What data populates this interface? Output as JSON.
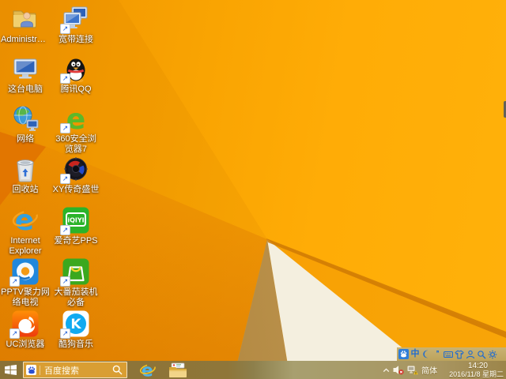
{
  "desktop": {
    "icons": [
      {
        "name": "administrator",
        "label": "Administrator",
        "shortcut": false
      },
      {
        "name": "broadband-connection",
        "label": "宽带连接",
        "shortcut": true
      },
      {
        "name": "this-pc",
        "label": "这台电脑",
        "shortcut": false
      },
      {
        "name": "tencent-qq",
        "label": "腾讯QQ",
        "shortcut": true
      },
      {
        "name": "network",
        "label": "网络",
        "shortcut": false
      },
      {
        "name": "360-browser",
        "label": "360安全浏览器7",
        "shortcut": true
      },
      {
        "name": "recycle-bin",
        "label": "回收站",
        "shortcut": false
      },
      {
        "name": "xy-game",
        "label": "XY传奇盛世",
        "shortcut": true
      },
      {
        "name": "internet-explorer",
        "label": "Internet Explorer",
        "shortcut": false
      },
      {
        "name": "iqiyi-pps",
        "label": "爱奇艺PPS",
        "shortcut": true
      },
      {
        "name": "pptv",
        "label": "PPTV聚力网络电视",
        "shortcut": true
      },
      {
        "name": "datomato",
        "label": "大番茄装机必备",
        "shortcut": true
      },
      {
        "name": "uc-browser",
        "label": "UC浏览器",
        "shortcut": true
      },
      {
        "name": "kugou-music",
        "label": "酷狗音乐",
        "shortcut": true
      }
    ]
  },
  "taskbar": {
    "search": {
      "placeholder": "百度搜索"
    },
    "apps": [
      {
        "name": "internet-explorer"
      },
      {
        "name": "file-explorer"
      }
    ],
    "ime_bar": {
      "mode_label": "中",
      "punct_label": "’’"
    },
    "tray": {
      "ime_indicator": "简体",
      "time": "14:20",
      "date": "2016/11/8 星期二"
    }
  },
  "colors": {
    "wallpaper_orange": "#F9A402",
    "wallpaper_fold_white": "#F2ECDA",
    "wallpaper_fold_tan": "#B98F48",
    "wallpaper_fold_burnt": "#E17300",
    "taskbar_tint": "#97803F",
    "ime_blue": "#1F6BD0",
    "search_box": "#D99E33"
  }
}
